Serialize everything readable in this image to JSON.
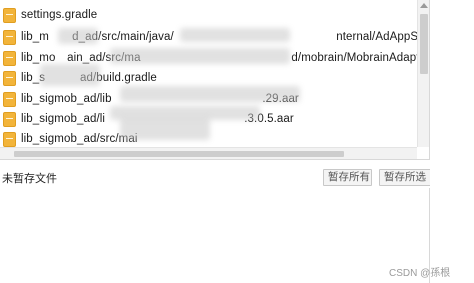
{
  "files": [
    {
      "name": "settings.gradle",
      "icon": "gradle-file-icon"
    },
    {
      "name": "lib_m  d_ad/src/main/java/              nternal/AdAppSetWor",
      "icon": "java-file-icon"
    },
    {
      "name": "lib_mo ain_ad/src/ma             d/mobrain/MobrainAdapt",
      "icon": "java-file-icon"
    },
    {
      "name": "lib_s   ad/build.gradle",
      "icon": "gradle-file-icon"
    },
    {
      "name": "lib_sigmob_ad/lib             .29.aar",
      "icon": "aar-file-icon"
    },
    {
      "name": "lib_sigmob_ad/li            .3.0.5.aar",
      "icon": "aar-file-icon"
    },
    {
      "name": "lib_sigmob_ad/src/mai",
      "icon": "java-file-icon"
    }
  ],
  "status": {
    "label": "未暂存文件"
  },
  "buttons": {
    "stage_all": "暂存所有",
    "stage_selected": "暂存所选"
  },
  "watermark": "CSDN @孫根",
  "colors": {
    "file_icon": "#f2b43a",
    "background": "#ffffff"
  }
}
